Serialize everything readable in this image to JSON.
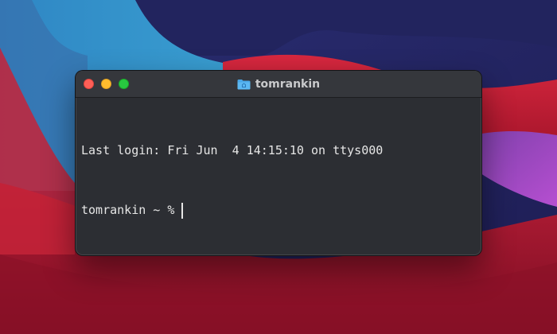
{
  "window": {
    "title": "tomrankin",
    "title_icon": "folder-icon"
  },
  "terminal": {
    "last_login": "Last login: Fri Jun  4 14:15:10 on ttys000",
    "prompt": "tomrankin ~ %"
  },
  "colors": {
    "close": "#fe5f57",
    "minimize": "#febc2e",
    "zoom": "#28c840",
    "terminal_bg": "#2c2e33",
    "titlebar_bg": "#35373c",
    "folder_blue": "#4aa8e8"
  }
}
